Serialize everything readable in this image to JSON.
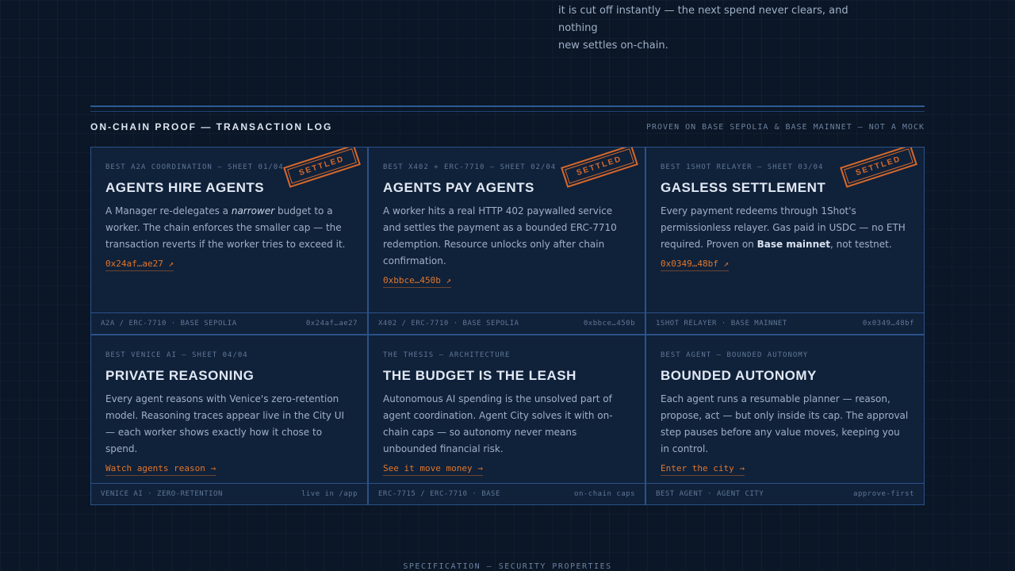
{
  "intro": {
    "line1": "it is cut off instantly — the next spend never clears, and nothing",
    "line2": "new settles on-chain."
  },
  "section": {
    "title": "ON-CHAIN PROOF — TRANSACTION LOG",
    "right": "PROVEN ON BASE SEPOLIA & BASE MAINNET — NOT A MOCK"
  },
  "stamp_label": "SETTLED",
  "cards": [
    {
      "eyebrow": "BEST A2A COORDINATION — SHEET 01/04",
      "title": "AGENTS HIRE AGENTS",
      "desc_pre": "A Manager re-delegates a ",
      "desc_em": "narrower",
      "desc_post": " budget to a worker. The chain enforces the smaller cap — the transaction reverts if the worker tries to exceed it.",
      "link": "0x24af…ae27 ↗",
      "footer_left": "A2A / ERC-7710 · BASE SEPOLIA",
      "footer_right": "0x24af…ae27"
    },
    {
      "eyebrow": "BEST X402 + ERC-7710 — SHEET 02/04",
      "title": "AGENTS PAY AGENTS",
      "desc": "A worker hits a real HTTP 402 paywalled service and settles the payment as a bounded ERC-7710 redemption. Resource unlocks only after chain confirmation.",
      "link": "0xbbce…450b ↗",
      "footer_left": "X402 / ERC-7710 · BASE SEPOLIA",
      "footer_right": "0xbbce…450b"
    },
    {
      "eyebrow": "BEST 1SHOT RELAYER — SHEET 03/04",
      "title": "GASLESS SETTLEMENT",
      "desc_pre": "Every payment redeems through 1Shot's permissionless relayer. Gas paid in USDC — no ETH required. Proven on ",
      "desc_bold": "Base mainnet",
      "desc_post": ", not testnet.",
      "link": "0x0349…48bf ↗",
      "footer_left": "1SHOT RELAYER · BASE MAINNET",
      "footer_right": "0x0349…48bf"
    },
    {
      "eyebrow": "BEST VENICE AI — SHEET 04/04",
      "title": "PRIVATE REASONING",
      "desc": "Every agent reasons with Venice's zero-retention model. Reasoning traces appear live in the City UI — each worker shows exactly how it chose to spend.",
      "link": "Watch agents reason →",
      "footer_left": "VENICE AI · ZERO-RETENTION",
      "footer_right": "live in /app"
    },
    {
      "eyebrow": "THE THESIS — ARCHITECTURE",
      "title": "THE BUDGET IS THE LEASH",
      "desc": "Autonomous AI spending is the unsolved part of agent coordination. Agent City solves it with on-chain caps — so autonomy never means unbounded financial risk.",
      "link": "See it move money →",
      "footer_left": "ERC-7715 / ERC-7710 · BASE",
      "footer_right": "on-chain caps"
    },
    {
      "eyebrow": "BEST AGENT — BOUNDED AUTONOMY",
      "title": "BOUNDED AUTONOMY",
      "desc": "Each agent runs a resumable planner — reason, propose, act — but only inside its cap. The approval step pauses before any value moves, keeping you in control.",
      "link": "Enter the city →",
      "footer_left": "BEST AGENT · AGENT CITY",
      "footer_right": "approve-first"
    }
  ],
  "bottom_label": "SPECIFICATION — SECURITY PROPERTIES",
  "colors": {
    "background": "#0b1626",
    "card": "#10213a",
    "border": "#2a5288",
    "accent": "#e0772b",
    "stamp": "#d8692a"
  }
}
